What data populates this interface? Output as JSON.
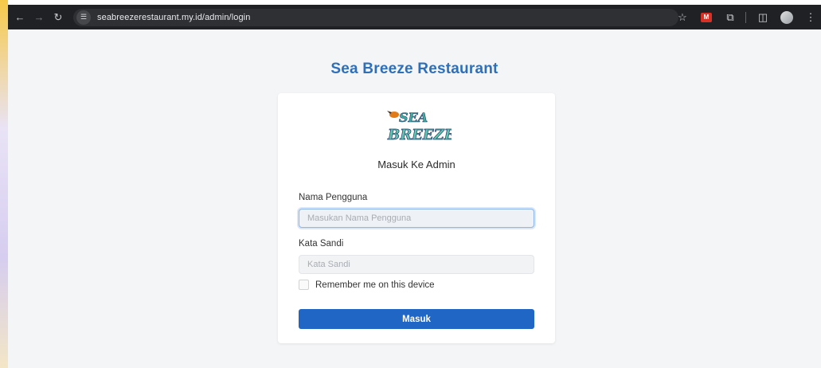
{
  "browser": {
    "url": "seabreezerestaurant.my.id/admin/login"
  },
  "page": {
    "brand_title": "Sea Breeze Restaurant",
    "logo_text": "SEA BREEZE"
  },
  "login": {
    "heading": "Masuk Ke Admin",
    "username_label": "Nama Pengguna",
    "username_placeholder": "Masukan Nama Pengguna",
    "username_value": "",
    "password_label": "Kata Sandi",
    "password_placeholder": "Kata Sandi",
    "password_value": "",
    "remember_label": "Remember me on this device",
    "remember_checked": false,
    "submit_label": "Masuk"
  },
  "colors": {
    "brand": "#2f6fb7",
    "button": "#2066c4",
    "chrome_bg": "#202124"
  }
}
